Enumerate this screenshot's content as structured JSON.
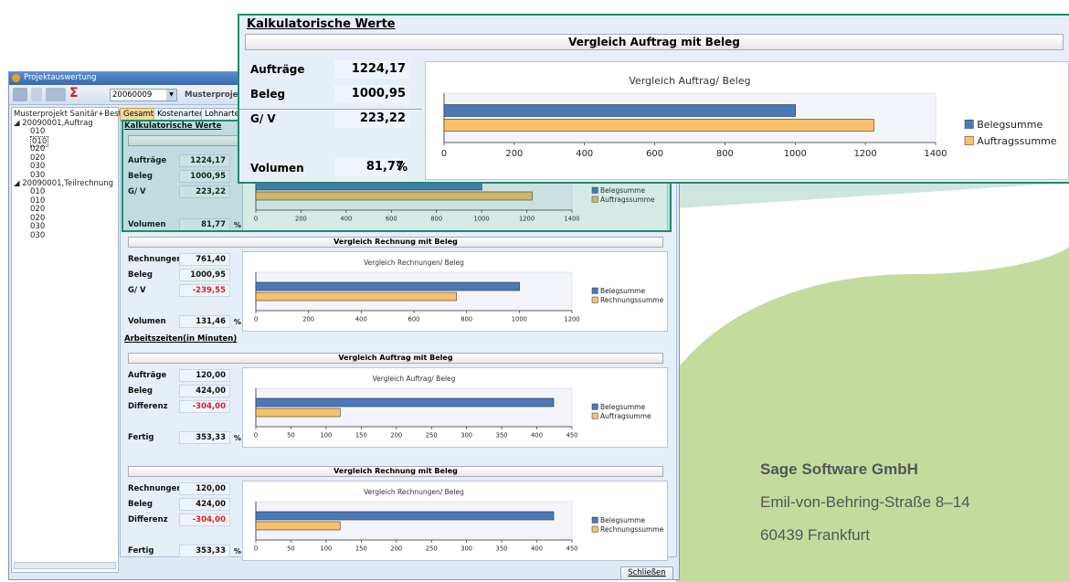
{
  "window": {
    "title": "Projektauswertung",
    "project_code": "20060009",
    "project_name": "Musterprojekt",
    "close_button": "Schließen"
  },
  "tree": {
    "root": "Musterprojekt Sanitär+Bestell",
    "nodes": [
      {
        "label": "20090001,Auftrag",
        "children": [
          "010",
          "010",
          "020",
          "020",
          "030",
          "030"
        ]
      },
      {
        "label": "20090001,Teilrechnung",
        "children": [
          "010",
          "010",
          "020",
          "020",
          "030",
          "030"
        ]
      }
    ]
  },
  "tabs": [
    "Gesamt",
    "Kostenarten",
    "Lohnarten"
  ],
  "sections": {
    "kalk_title": "Kalkulatorische Werte",
    "arbeit_title": "Arbeitszeiten(in Minuten)"
  },
  "blocks": [
    {
      "header": "Vergleich Auftrag mit Beleg",
      "rows": [
        {
          "label": "Aufträge",
          "value": "1224,17"
        },
        {
          "label": "Beleg",
          "value": "1000,95"
        },
        {
          "label": "G/ V",
          "value": "223,22"
        }
      ],
      "footer_label": "Volumen",
      "footer_value": "81,77",
      "footer_unit": "%"
    },
    {
      "header": "Vergleich Rechnung mit Beleg",
      "rows": [
        {
          "label": "Rechnungen",
          "value": "761,40"
        },
        {
          "label": "Beleg",
          "value": "1000,95"
        },
        {
          "label": "G/ V",
          "value": "-239,55"
        }
      ],
      "footer_label": "Volumen",
      "footer_value": "131,46",
      "footer_unit": "%"
    },
    {
      "header": "Vergleich Auftrag mit Beleg",
      "rows": [
        {
          "label": "Aufträge",
          "value": "120,00"
        },
        {
          "label": "Beleg",
          "value": "424,00"
        },
        {
          "label": "Differenz",
          "value": "-304,00"
        }
      ],
      "footer_label": "Fertig",
      "footer_value": "353,33",
      "footer_unit": "%"
    },
    {
      "header": "Vergleich Rechnung mit Beleg",
      "rows": [
        {
          "label": "Rechnungen",
          "value": "120,00"
        },
        {
          "label": "Beleg",
          "value": "424,00"
        },
        {
          "label": "Differenz",
          "value": "-304,00"
        }
      ],
      "footer_label": "Fertig",
      "footer_value": "353,33",
      "footer_unit": "%"
    }
  ],
  "chart_data": [
    {
      "type": "bar",
      "orientation": "horizontal",
      "title": "Vergleich Auftrag/ Beleg",
      "xlim": [
        0,
        1400
      ],
      "ticks": [
        0,
        200,
        400,
        600,
        800,
        1000,
        1200,
        1400
      ],
      "series": [
        {
          "name": "Belegsumme",
          "values": [
            1000.95
          ]
        },
        {
          "name": "Auftragssumme",
          "values": [
            1224.17
          ]
        }
      ],
      "legend": "right"
    },
    {
      "type": "bar",
      "orientation": "horizontal",
      "title": "Vergleich Rechnungen/ Beleg",
      "xlim": [
        0,
        1200
      ],
      "ticks": [
        0,
        200,
        400,
        600,
        800,
        1000,
        1200
      ],
      "series": [
        {
          "name": "Belegsumme",
          "values": [
            1000.95
          ]
        },
        {
          "name": "Rechnungssumme",
          "values": [
            761.4
          ]
        }
      ],
      "legend": "right"
    },
    {
      "type": "bar",
      "orientation": "horizontal",
      "title": "Vergleich Auftrag/ Beleg",
      "xlim": [
        0,
        450
      ],
      "ticks": [
        0,
        50,
        100,
        150,
        200,
        250,
        300,
        350,
        400,
        450
      ],
      "series": [
        {
          "name": "Belegsumme",
          "values": [
            424
          ]
        },
        {
          "name": "Auftragsumme",
          "values": [
            120
          ]
        }
      ],
      "legend": "right"
    },
    {
      "type": "bar",
      "orientation": "horizontal",
      "title": "Vergleich Rechnungen/ Beleg",
      "xlim": [
        0,
        450
      ],
      "ticks": [
        0,
        50,
        100,
        150,
        200,
        250,
        300,
        350,
        400,
        450
      ],
      "series": [
        {
          "name": "Belegsumme",
          "values": [
            424
          ]
        },
        {
          "name": "Rechnungssumme",
          "values": [
            120
          ]
        }
      ],
      "legend": "right"
    }
  ],
  "colors": {
    "beleg": "#4a78b8",
    "auftrag": "#f8c06a",
    "teal": "#1d8c6e",
    "green_bg": "#c3dc9e",
    "teal_bg": "#c9e3dd"
  },
  "company": {
    "name": "Sage Software GmbH",
    "street": "Emil-von-Behring-Straße 8–14",
    "city": "60439 Frankfurt"
  }
}
